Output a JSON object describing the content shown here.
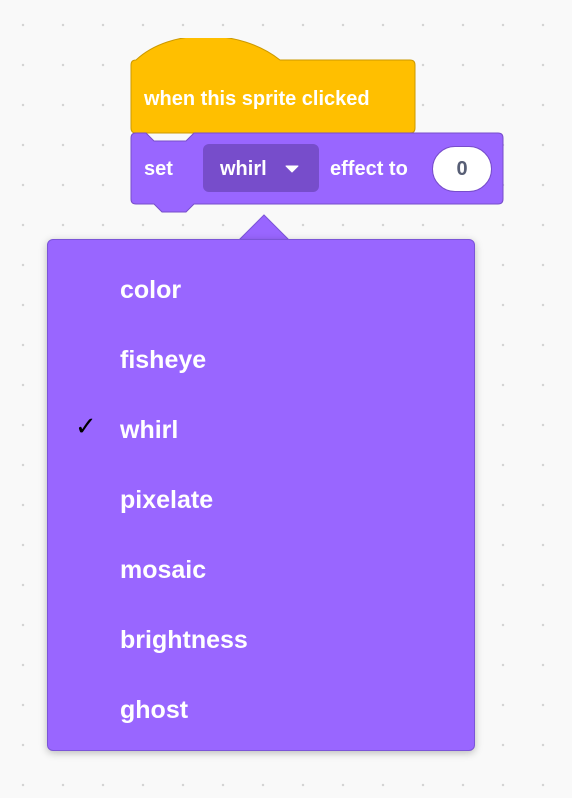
{
  "hat_block": {
    "label": "when this sprite clicked",
    "color": "#ffbf00"
  },
  "set_block": {
    "set_label": "set",
    "dropdown_value": "whirl",
    "effect_label": "effect to",
    "number_value": "0",
    "color": "#9966ff",
    "dropdown_color": "#774dcb"
  },
  "dropdown_menu": {
    "selected": "whirl",
    "check_glyph": "✓",
    "items": [
      {
        "label": "color"
      },
      {
        "label": "fisheye"
      },
      {
        "label": "whirl"
      },
      {
        "label": "pixelate"
      },
      {
        "label": "mosaic"
      },
      {
        "label": "brightness"
      },
      {
        "label": "ghost"
      }
    ]
  },
  "icons": {
    "caret": "caret-down-icon",
    "check": "checkmark-icon"
  }
}
